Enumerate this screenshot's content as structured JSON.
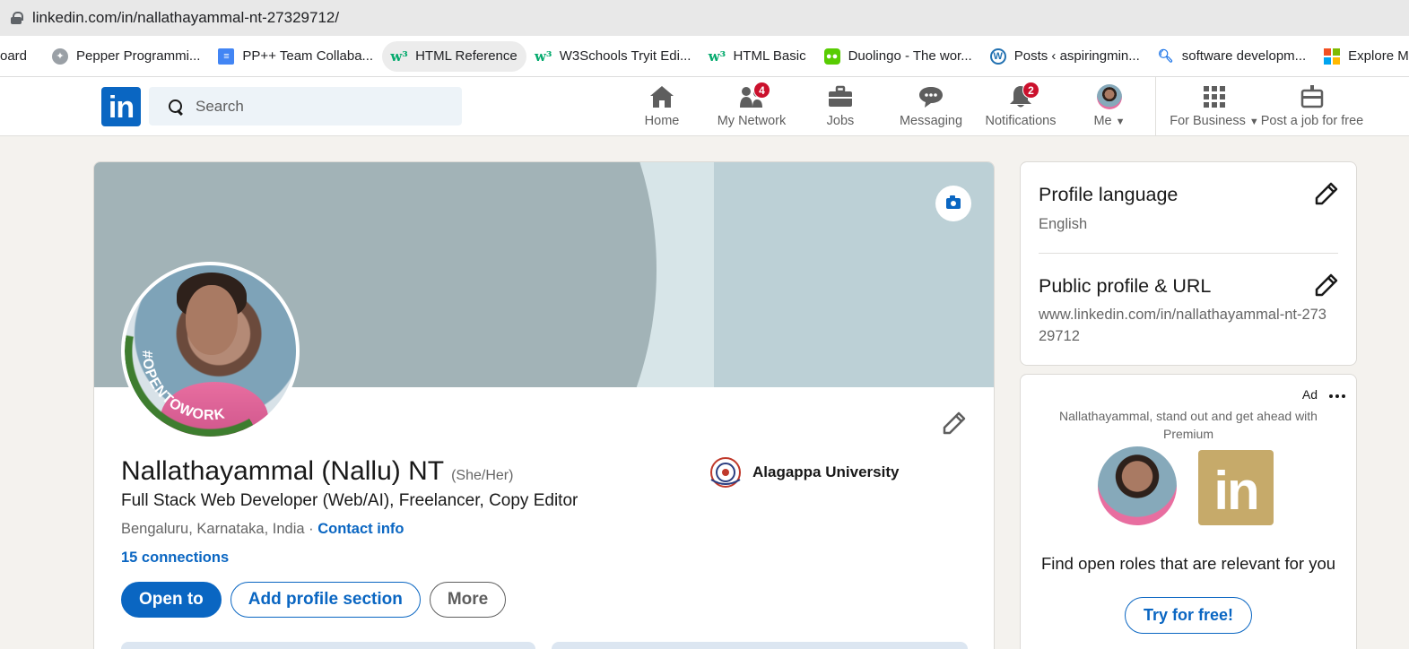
{
  "browser": {
    "url": "linkedin.com/in/nallathayammal-nt-27329712/",
    "bookmarks": [
      {
        "label": "oard",
        "icon": "none"
      },
      {
        "label": "Pepper Programmi...",
        "icon": "compass-icon"
      },
      {
        "label": "PP++ Team Collaba...",
        "icon": "docs-icon"
      },
      {
        "label": "HTML Reference",
        "icon": "w3schools-icon"
      },
      {
        "label": "W3Schools Tryit Edi...",
        "icon": "w3schools-icon"
      },
      {
        "label": "HTML Basic",
        "icon": "w3schools-icon"
      },
      {
        "label": "Duolingo - The wor...",
        "icon": "duolingo-icon"
      },
      {
        "label": "Posts ‹ aspiringmin...",
        "icon": "wordpress-icon"
      },
      {
        "label": "software developm...",
        "icon": "search-icon"
      },
      {
        "label": "Explore Mi",
        "icon": "microsoft-icon"
      }
    ]
  },
  "nav": {
    "logo": "in",
    "search_placeholder": "Search",
    "items": [
      {
        "label": "Home",
        "icon": "home-icon",
        "badge": ""
      },
      {
        "label": "My Network",
        "icon": "network-icon",
        "badge": "4"
      },
      {
        "label": "Jobs",
        "icon": "briefcase-icon",
        "badge": ""
      },
      {
        "label": "Messaging",
        "icon": "chat-icon",
        "badge": ""
      },
      {
        "label": "Notifications",
        "icon": "bell-icon",
        "badge": "2"
      },
      {
        "label": "Me",
        "icon": "avatar-icon",
        "badge": ""
      },
      {
        "label": "For Business",
        "icon": "grid-icon",
        "badge": ""
      },
      {
        "label": "Post a job for free",
        "icon": "post-job-icon",
        "badge": ""
      }
    ]
  },
  "profile": {
    "open_to_work_badge": "#OPENTOWORK",
    "name": "Nallathayammal (Nallu) NT",
    "pronouns": "(She/Her)",
    "headline": "Full Stack Web Developer (Web/AI), Freelancer, Copy Editor",
    "location": "Bengaluru, Karnataka, India",
    "separator": " · ",
    "contact_info": "Contact info",
    "connections": "15 connections",
    "education": "Alagappa University",
    "buttons": {
      "open_to": "Open to",
      "add_section": "Add profile section",
      "more": "More"
    }
  },
  "sidebar": {
    "profile_language": {
      "title": "Profile language",
      "value": "English"
    },
    "public_profile": {
      "title": "Public profile & URL",
      "value": "www.linkedin.com/in/nallathayammal-nt-27329712"
    }
  },
  "ad": {
    "label": "Ad",
    "text": "Nallathayammal, stand out and get ahead with Premium",
    "logo": "in",
    "find_text": "Find open roles that are relevant for you",
    "cta": "Try for free!"
  },
  "colors": {
    "linkedin_blue": "#0a66c2",
    "badge_red": "#cb112d",
    "open_to_work_green": "#3e7d2f",
    "premium_gold": "#c6aa6a"
  }
}
